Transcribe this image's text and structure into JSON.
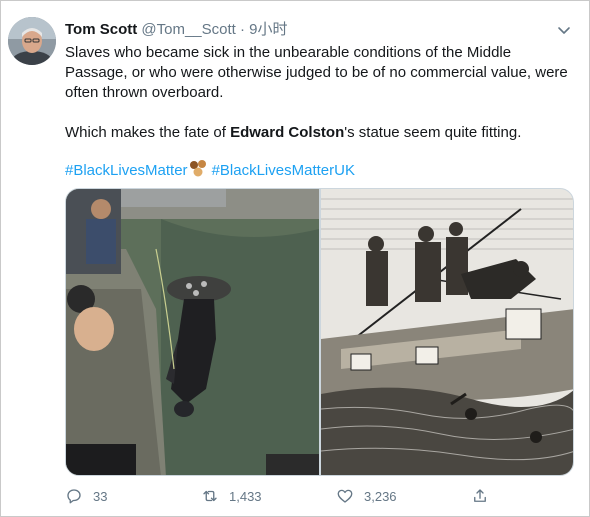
{
  "tweet": {
    "author_name": "Tom Scott",
    "handle": "@Tom__Scott",
    "separator": "·",
    "time": "9小时",
    "line1": "Slaves who became sick in the unbearable conditions of the Middle Passage, or who were otherwise judged to be of no commercial value, were often thrown overboard.",
    "line2_prefix": "Which makes the fate of ",
    "line2_bold": "Edward Colston",
    "line2_suffix": "'s statue seem quite fitting.",
    "hashtag1": "#BlackLivesMatter",
    "hashtag2": "#BlackLivesMatterUK"
  },
  "icons": {
    "caret": "chevron-down-icon",
    "reply": "reply-icon",
    "retweet": "retweet-icon",
    "like": "heart-icon",
    "share": "share-icon",
    "emoji": "raised-fists-emoji"
  },
  "actions": {
    "replies": "33",
    "retweets": "1,433",
    "likes": "3,236"
  },
  "colors": {
    "link": "#1da1f2",
    "secondary_text": "#657786",
    "primary_text": "#14171a"
  }
}
